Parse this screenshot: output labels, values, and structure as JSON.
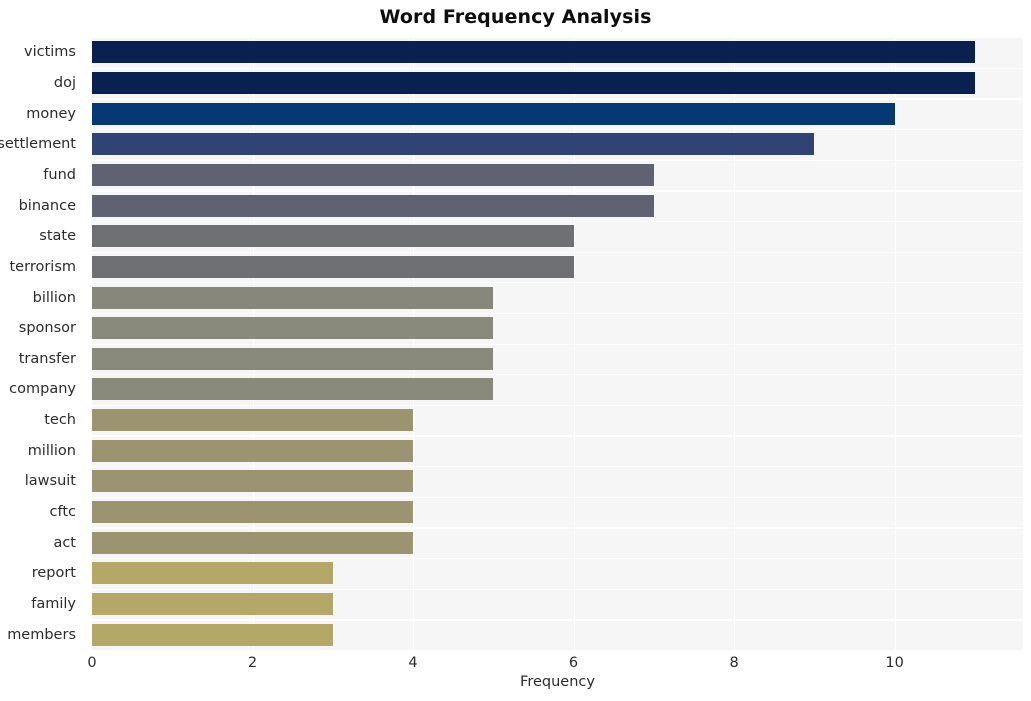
{
  "chart_data": {
    "type": "bar",
    "orientation": "horizontal",
    "title": "Word Frequency Analysis",
    "xlabel": "Frequency",
    "ylabel": "",
    "xlim": [
      0,
      11.6
    ],
    "ylim": null,
    "grid": true,
    "legend": null,
    "xticks": [
      0,
      2,
      4,
      6,
      8,
      10
    ],
    "xtick_labels": [
      "0",
      "2",
      "4",
      "6",
      "8",
      "10"
    ],
    "categories": [
      "victims",
      "doj",
      "money",
      "settlement",
      "fund",
      "binance",
      "state",
      "terrorism",
      "billion",
      "sponsor",
      "transfer",
      "company",
      "tech",
      "million",
      "lawsuit",
      "cftc",
      "act",
      "report",
      "family",
      "members"
    ],
    "values": [
      11,
      11,
      10,
      9,
      7,
      7,
      6,
      6,
      5,
      5,
      5,
      5,
      4,
      4,
      4,
      4,
      4,
      3,
      3,
      3
    ],
    "bar_colors": [
      "#0a2150",
      "#0a2150",
      "#063873",
      "#2f4474",
      "#5e6272",
      "#5e6272",
      "#6e7073",
      "#6e7073",
      "#87877b",
      "#8a8a7c",
      "#8a8a7c",
      "#8a8a7c",
      "#9c9470",
      "#9c9470",
      "#9c9470",
      "#9c9470",
      "#9c9470",
      "#b3a868",
      "#b3a868",
      "#b3a868"
    ],
    "plot_background": "#f6f6f7",
    "grid_color": "#ffffff",
    "figure_background": "#ffffff"
  }
}
